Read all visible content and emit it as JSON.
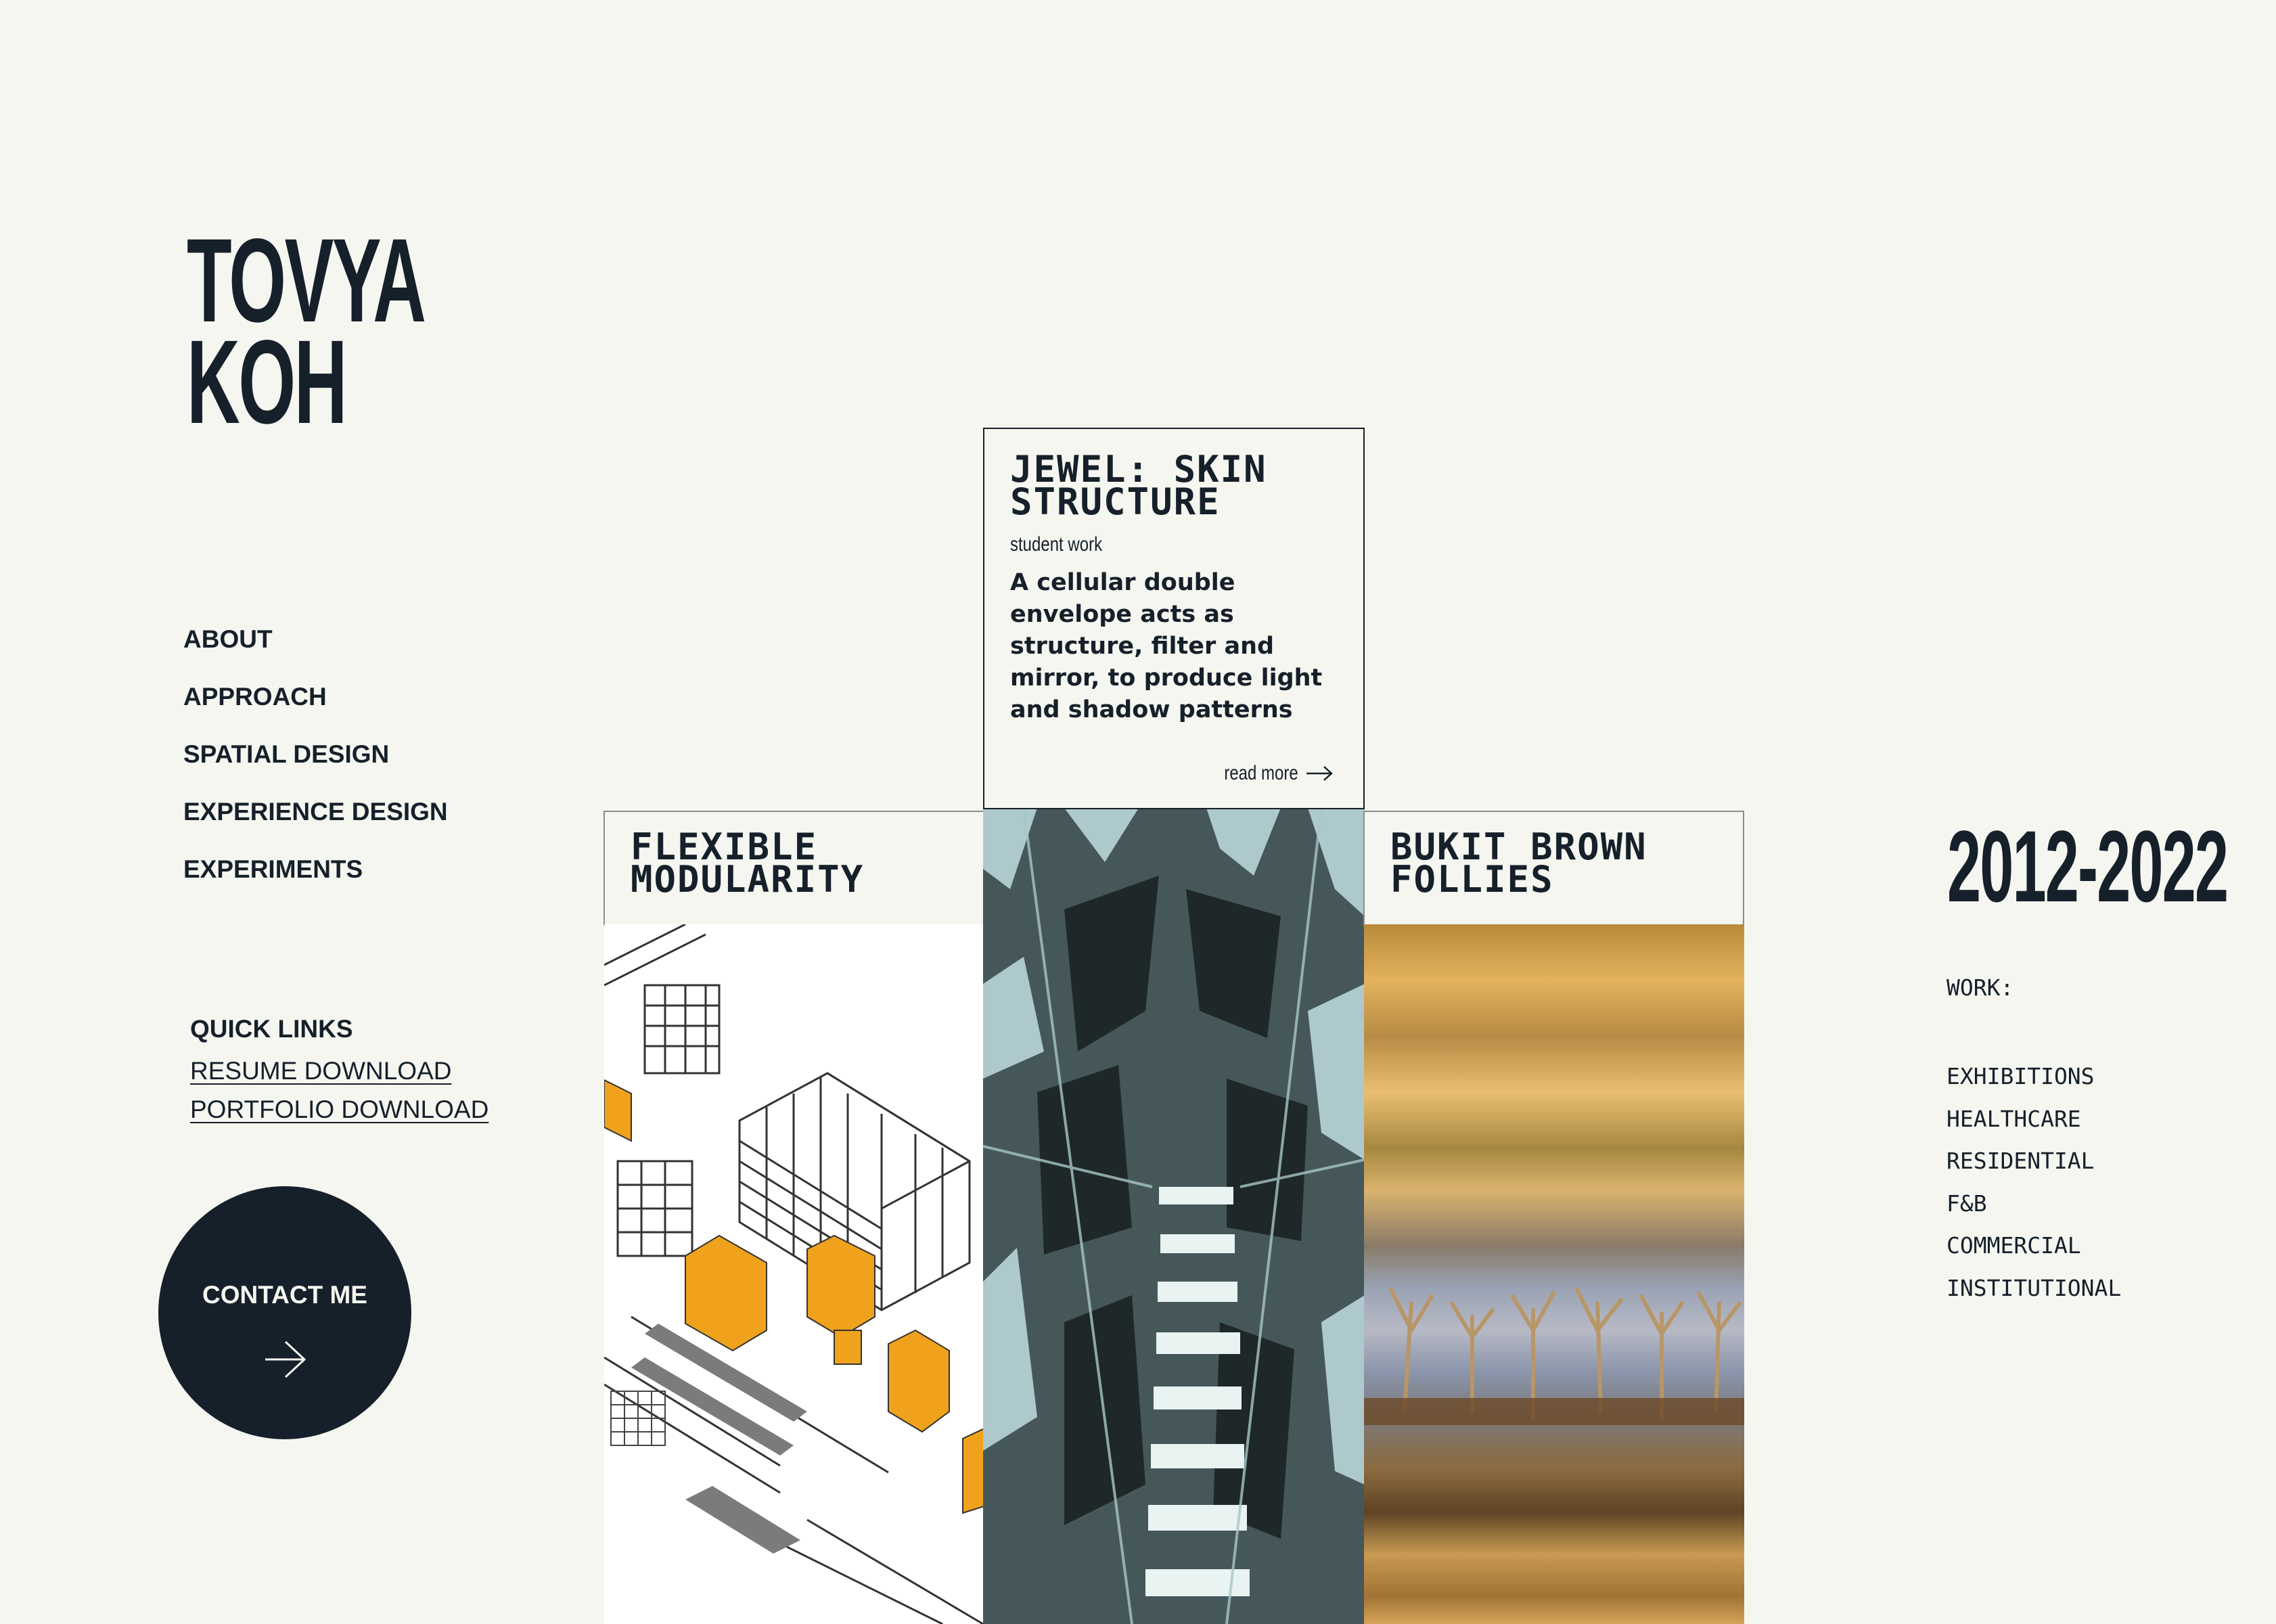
{
  "logo": {
    "line1": "TOVYA",
    "line2": "KOH"
  },
  "nav": {
    "items": [
      {
        "label": "ABOUT"
      },
      {
        "label": "APPROACH"
      },
      {
        "label": "SPATIAL DESIGN"
      },
      {
        "label": "EXPERIENCE DESIGN"
      },
      {
        "label": "EXPERIMENTS"
      }
    ]
  },
  "quick_links": {
    "heading": "QUICK LINKS",
    "resume": "RESUME DOWNLOAD",
    "portfolio": "PORTFOLIO DOWNLOAD"
  },
  "contact": {
    "label": "CONTACT ME",
    "icon": "arrow-right-icon"
  },
  "projects": {
    "featured": {
      "title": "JEWEL: SKIN\nSTRUCTURE",
      "kind": "student work",
      "description": "A cellular double envelope acts as structure, filter and mirror, to produce light and shadow patterns",
      "read_more": "read more"
    },
    "left": {
      "title": "FLEXIBLE\nMODULARITY"
    },
    "right": {
      "title": "BUKIT BROWN\nFOLLIES"
    }
  },
  "sidebar_right": {
    "years": "2012-2022",
    "work_label": "WORK:",
    "categories": [
      "EXHIBITIONS",
      "HEALTHCARE",
      "RESIDENTIAL",
      "F&B",
      "COMMERCIAL",
      "INSTITUTIONAL"
    ]
  },
  "colors": {
    "background": "#f5f6f0",
    "ink": "#16202a",
    "accent_orange": "#f0a21c",
    "border": "#8a8d88"
  }
}
